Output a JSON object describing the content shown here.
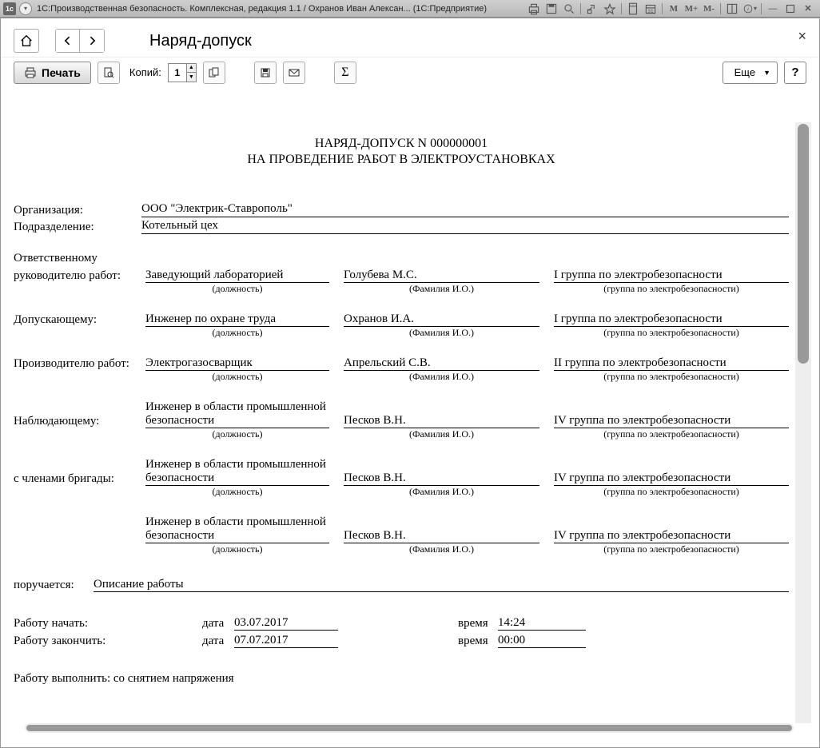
{
  "titlebar": {
    "app_icon": "1c",
    "title": "1С:Производственная безопасность. Комплексная, редакция 1.1 / Охранов Иван Алексан...   (1С:Предприятие)",
    "m1": "M",
    "m2": "M+",
    "m3": "M-"
  },
  "nav": {
    "page_title": "Наряд-допуск"
  },
  "toolbar": {
    "print_label": "Печать",
    "copies_label": "Копий:",
    "copies_value": "1",
    "more_label": "Еще",
    "help_label": "?"
  },
  "doc": {
    "title1": "НАРЯД-ДОПУСК N 000000001",
    "title2": "НА ПРОВЕДЕНИЕ РАБОТ В ЭЛЕКТРОУСТАНОВКАХ",
    "org_label": "Организация:",
    "org_value": "ООО \"Электрик-Ставрополь\"",
    "dept_label": "Подразделение:",
    "dept_value": "Котельный цех",
    "resp_label": "Ответственному",
    "sub_post": "(должность)",
    "sub_name": "(Фамилия И.О.)",
    "sub_group": "(группа по электробезопасности)",
    "rows": [
      {
        "label": "руководителю работ:",
        "post": "Заведующий лабораторией",
        "name": "Голубева М.С.",
        "group": "I группа по электробезопасности"
      },
      {
        "label": "Допускающему:",
        "post": "Инженер по охране труда",
        "name": "Охранов И.А.",
        "group": "I группа по электробезопасности"
      },
      {
        "label": "Производителю работ:",
        "post": "Электрогазосварщик",
        "name": "Апрельский С.В.",
        "group": "II группа по электробезопасности"
      },
      {
        "label": "Наблюдающему:",
        "post": "Инженер в области промышленной безопасности",
        "name": "Песков В.Н.",
        "group": "IV группа по электробезопасности"
      },
      {
        "label": "с членами бригады:",
        "post": "Инженер в области промышленной безопасности",
        "name": "Песков В.Н.",
        "group": "IV группа по электробезопасности"
      },
      {
        "label": "",
        "post": "Инженер в области промышленной безопасности",
        "name": "Песков В.Н.",
        "group": "IV группа по электробезопасности"
      }
    ],
    "task_label": "поручается:",
    "task_value": "Описание работы",
    "start_label": "Работу начать:",
    "end_label": "Работу закончить:",
    "date_label": "дата",
    "time_label": "время",
    "start_date": "03.07.2017",
    "start_time": "14:24",
    "end_date": "07.07.2017",
    "end_time": "00:00",
    "perform_label": "Работу выполнить: со снятием напряжения"
  }
}
